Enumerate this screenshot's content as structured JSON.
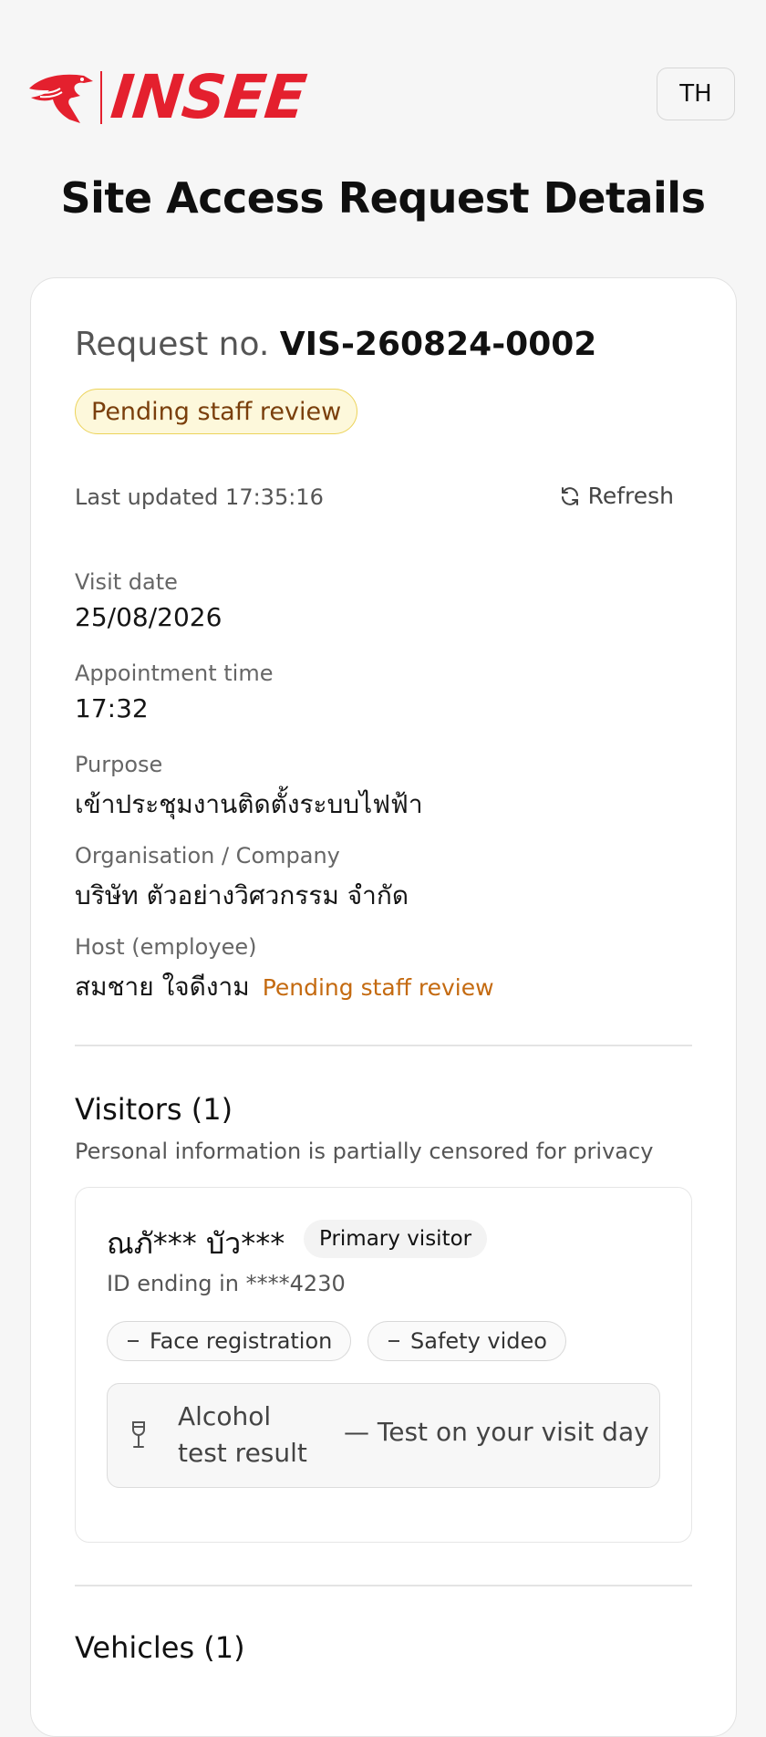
{
  "header": {
    "logo_text": "INSEE",
    "language_button": "TH"
  },
  "page_title": "Site Access Request Details",
  "request": {
    "number_label": "Request no.",
    "number": "VIS-260824-0002",
    "status": "Pending staff review",
    "last_updated": "Last updated 17:35:16",
    "refresh_label": "Refresh"
  },
  "details": {
    "visit_date_label": "Visit date",
    "visit_date": "25/08/2026",
    "appointment_label": "Appointment time",
    "appointment_time": "17:32",
    "purpose_label": "Purpose",
    "purpose": "เข้าประชุมงานติดตั้งระบบไฟฟ้า",
    "company_label": "Organisation / Company",
    "company": "บริษัท ตัวอย่างวิศวกรรม จำกัด",
    "host_label": "Host (employee)",
    "host_name": "สมชาย ใจดีงาม",
    "host_status": "Pending staff review"
  },
  "visitors": {
    "title": "Visitors (1)",
    "note": "Personal information is partially censored for privacy",
    "items": [
      {
        "name": "ณภั*** บัว***",
        "role_badge": "Primary visitor",
        "id_line": "ID ending in ****4230",
        "chips": [
          {
            "icon": "dash-icon",
            "label": "Face registration"
          },
          {
            "icon": "dash-icon",
            "label": "Safety video"
          }
        ],
        "alcohol_label": "Alcohol test result",
        "alcohol_value": "— Test on your visit day"
      }
    ]
  },
  "vehicles": {
    "title": "Vehicles (1)"
  },
  "colors": {
    "brand": "#e4202e",
    "status_text": "#7a3f0c",
    "status_bg": "#fdf8db",
    "status_border": "#ecd35a",
    "host_status": "#c46a10"
  }
}
